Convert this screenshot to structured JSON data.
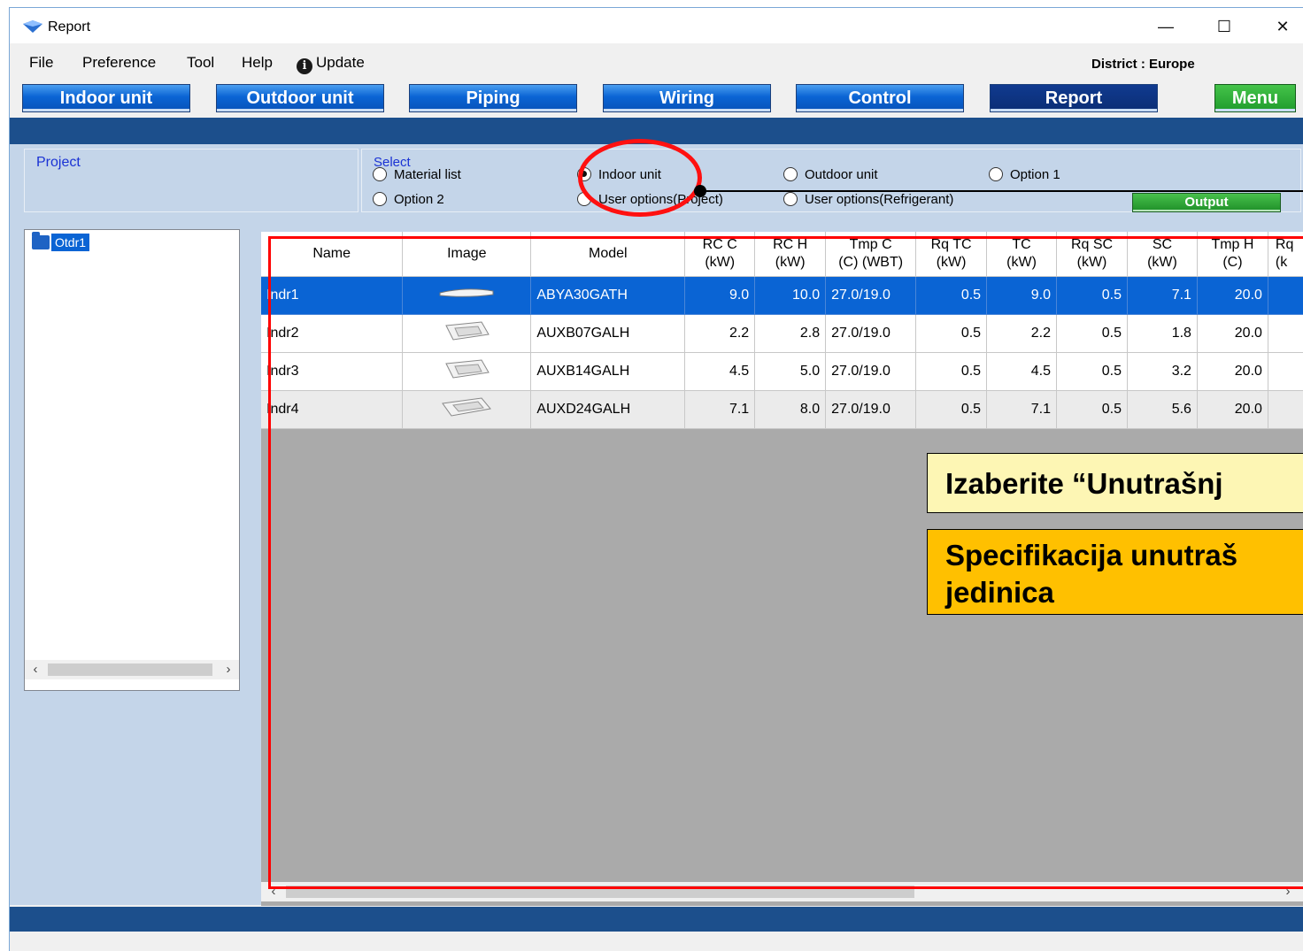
{
  "window": {
    "title": "Report"
  },
  "menu": {
    "file": "File",
    "preference": "Preference",
    "tool": "Tool",
    "help": "Help",
    "update": "Update"
  },
  "district": "District : Europe",
  "toolbar": {
    "indoor": "Indoor unit",
    "outdoor": "Outdoor unit",
    "piping": "Piping",
    "wiring": "Wiring",
    "control": "Control",
    "report": "Report",
    "menu": "Menu"
  },
  "project": {
    "label": "Project"
  },
  "select": {
    "label": "Select",
    "material_list": "Material list",
    "indoor_unit": "Indoor unit",
    "outdoor_unit": "Outdoor unit",
    "option1": "Option 1",
    "option2": "Option 2",
    "user_options_project": "User options(Project)",
    "user_options_refrigerant": "User options(Refrigerant)",
    "selected": "Indoor unit"
  },
  "output_button": "Output",
  "tree": {
    "node": "Otdr1"
  },
  "table": {
    "headers": [
      {
        "top": "Name",
        "bottom": ""
      },
      {
        "top": "Image",
        "bottom": ""
      },
      {
        "top": "Model",
        "bottom": ""
      },
      {
        "top": "RC C",
        "bottom": "(kW)"
      },
      {
        "top": "RC H",
        "bottom": "(kW)"
      },
      {
        "top": "Tmp C",
        "bottom": "(C) (WBT)"
      },
      {
        "top": "Rq TC",
        "bottom": "(kW)"
      },
      {
        "top": "TC",
        "bottom": "(kW)"
      },
      {
        "top": "Rq SC",
        "bottom": "(kW)"
      },
      {
        "top": "SC",
        "bottom": "(kW)"
      },
      {
        "top": "Tmp H",
        "bottom": "(C)"
      },
      {
        "top": "Rq",
        "bottom": "(k"
      }
    ],
    "rows": [
      {
        "name": "Indr1",
        "model": "ABYA30GATH",
        "rcc": "9.0",
        "rch": "10.0",
        "tmpc": "27.0/19.0",
        "rqtc": "0.5",
        "tc": "9.0",
        "rqsc": "0.5",
        "sc": "7.1",
        "tmph": "20.0"
      },
      {
        "name": "Indr2",
        "model": "AUXB07GALH",
        "rcc": "2.2",
        "rch": "2.8",
        "tmpc": "27.0/19.0",
        "rqtc": "0.5",
        "tc": "2.2",
        "rqsc": "0.5",
        "sc": "1.8",
        "tmph": "20.0"
      },
      {
        "name": "Indr3",
        "model": "AUXB14GALH",
        "rcc": "4.5",
        "rch": "5.0",
        "tmpc": "27.0/19.0",
        "rqtc": "0.5",
        "tc": "4.5",
        "rqsc": "0.5",
        "sc": "3.2",
        "tmph": "20.0"
      },
      {
        "name": "Indr4",
        "model": "AUXD24GALH",
        "rcc": "7.1",
        "rch": "8.0",
        "tmpc": "27.0/19.0",
        "rqtc": "0.5",
        "tc": "7.1",
        "rqsc": "0.5",
        "sc": "5.6",
        "tmph": "20.0"
      }
    ]
  },
  "notes": {
    "note1": "Izaberite “Unutrašnj",
    "note2_line1": "Specifikacija unutraš",
    "note2_line2": "jedinica"
  }
}
